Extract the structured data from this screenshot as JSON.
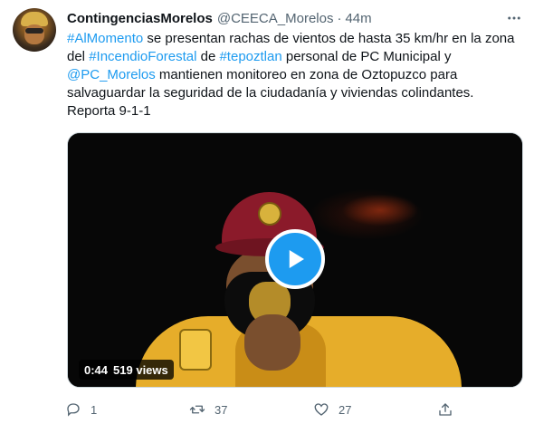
{
  "tweet": {
    "author": {
      "name": "ContingenciasMorelos",
      "handle": "@CEECA_Morelos",
      "separator": "·",
      "time": "44m"
    },
    "text": {
      "hashtag_1": "#AlMomento",
      "t1": " se presentan rachas de  vientos de hasta 35 km/hr en la zona del ",
      "hashtag_2": "#IncendioForestal",
      "t2": " de ",
      "hashtag_3": "#tepoztlan",
      "t3": " personal de PC  Municipal y ",
      "mention_1": "@PC_Morelos",
      "t4": " mantienen monitoreo en zona de Oztopuzco para salvaguardar la seguridad de la ciudadanía y viviendas colindantes. Reporta 9-1-1"
    },
    "video": {
      "duration": "0:44",
      "views": "519 views"
    },
    "actions": {
      "reply_count": "1",
      "retweet_count": "37",
      "like_count": "27"
    }
  },
  "icons": [
    "more-icon",
    "play-icon",
    "reply-icon",
    "retweet-icon",
    "like-icon",
    "share-icon"
  ],
  "colors": {
    "link": "#1d9bf0",
    "secondary_text": "#536471",
    "primary_text": "#0f1419",
    "play_button": "#1d9bf0"
  }
}
